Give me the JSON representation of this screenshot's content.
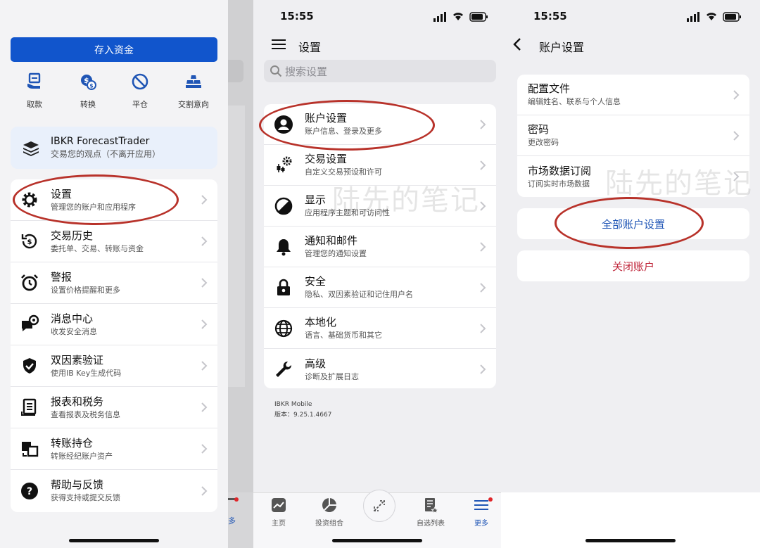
{
  "panel1": {
    "deposit_button": "存入资金",
    "quick_actions": [
      {
        "label": "取款",
        "icon": "withdraw-icon"
      },
      {
        "label": "转换",
        "icon": "currency-convert-icon"
      },
      {
        "label": "平仓",
        "icon": "close-position-icon"
      },
      {
        "label": "交割意向",
        "icon": "delivery-intent-icon"
      }
    ],
    "forecast": {
      "title": "IBKR ForecastTrader",
      "subtitle": "交易您的观点（不离开应用）"
    },
    "menu": [
      {
        "title": "设置",
        "subtitle": "管理您的账户和应用程序",
        "icon": "gear-icon"
      },
      {
        "title": "交易历史",
        "subtitle": "委托单、交易、转账与资金",
        "icon": "history-icon"
      },
      {
        "title": "警报",
        "subtitle": "设置价格提醒和更多",
        "icon": "alarm-icon"
      },
      {
        "title": "消息中心",
        "subtitle": "收发安全消息",
        "icon": "message-icon"
      },
      {
        "title": "双因素验证",
        "subtitle": "使用IB Key生成代码",
        "icon": "shield-icon"
      },
      {
        "title": "报表和税务",
        "subtitle": "查看报表及税务信息",
        "icon": "report-icon"
      },
      {
        "title": "转账持仓",
        "subtitle": "转账经纪账户资产",
        "icon": "transfer-icon"
      },
      {
        "title": "帮助与反馈",
        "subtitle": "获得支持或提交反馈",
        "icon": "help-icon"
      }
    ],
    "peek_more": "多"
  },
  "panel2": {
    "time": "15:55",
    "title": "设置",
    "search_placeholder": "搜索设置",
    "items": [
      {
        "title": "账户设置",
        "subtitle": "账户信息、登录及更多",
        "icon": "user-icon"
      },
      {
        "title": "交易设置",
        "subtitle": "自定义交易预设和许可",
        "icon": "trade-settings-icon"
      },
      {
        "title": "显示",
        "subtitle": "应用程序主题和可访问性",
        "icon": "display-icon"
      },
      {
        "title": "通知和邮件",
        "subtitle": "管理您的通知设置",
        "icon": "bell-icon"
      },
      {
        "title": "安全",
        "subtitle": "隐私、双因素验证和记住用户名",
        "icon": "lock-icon"
      },
      {
        "title": "本地化",
        "subtitle": "语言、基础货币和其它",
        "icon": "globe-icon"
      },
      {
        "title": "高级",
        "subtitle": "诊断及扩展日志",
        "icon": "wrench-icon"
      }
    ],
    "footer_app": "IBKR Mobile",
    "footer_version": "版本：9.25.1.4667",
    "tabs": [
      {
        "label": "主页",
        "icon": "home-chart-icon"
      },
      {
        "label": "投资组合",
        "icon": "portfolio-icon"
      },
      {
        "label": "",
        "icon": "trade-fab-icon"
      },
      {
        "label": "自选列表",
        "icon": "watchlist-icon"
      },
      {
        "label": "更多",
        "icon": "more-menu-icon"
      }
    ]
  },
  "panel3": {
    "time": "15:55",
    "title": "账户设置",
    "items": [
      {
        "title": "配置文件",
        "subtitle": "编辑姓名、联系与个人信息"
      },
      {
        "title": "密码",
        "subtitle": "更改密码"
      },
      {
        "title": "市场数据订阅",
        "subtitle": "订阅实时市场数据"
      }
    ],
    "all_settings": "全部账户设置",
    "close_account": "关闭账户"
  },
  "watermark": "陆先的笔记",
  "colors": {
    "accent": "#1155cc",
    "link": "#1f55b5",
    "danger": "#c0283c",
    "highlight_oval": "#b8322a",
    "badge": "#e0262a"
  }
}
